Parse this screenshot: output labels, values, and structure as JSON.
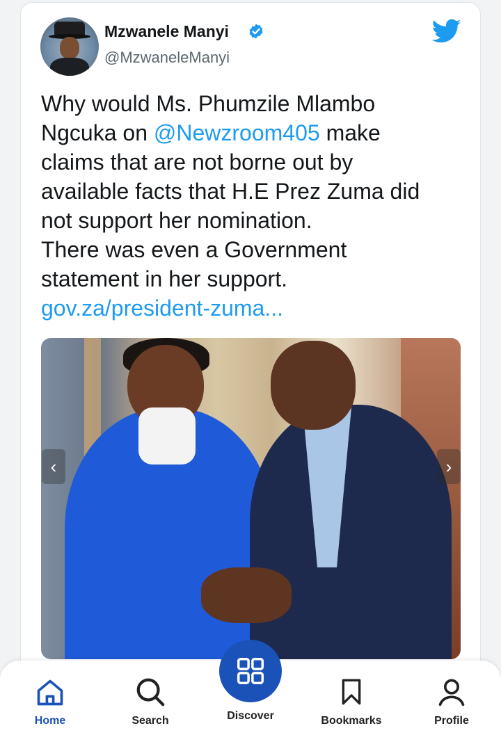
{
  "tweet": {
    "author_name": "Mzwanele Manyi",
    "author_handle": "@MzwaneleManyi",
    "text_lines": [
      "Why would Ms. Phumzile Mlambo",
      "Ngcuka on ",
      "@Newzroom405",
      " make",
      "claims that  are not borne out by",
      "available facts that H.E Prez Zuma did",
      "not support her nomination.",
      "There was even a Government",
      "statement in her support."
    ],
    "link": "gov.za/president-zuma..."
  },
  "media": {
    "prev_glyph": "‹",
    "next_glyph": "›"
  },
  "nav": {
    "home": "Home",
    "search": "Search",
    "discover": "Discover",
    "bookmarks": "Bookmarks",
    "profile": "Profile"
  },
  "colors": {
    "accent_link": "#1d9bf0",
    "nav_active": "#1a52b8"
  },
  "icons": [
    "verified-badge-icon",
    "twitter-bird-icon",
    "chevron-left-icon",
    "chevron-right-icon",
    "home-icon",
    "search-icon",
    "grid-icon",
    "bookmark-icon",
    "profile-icon"
  ]
}
